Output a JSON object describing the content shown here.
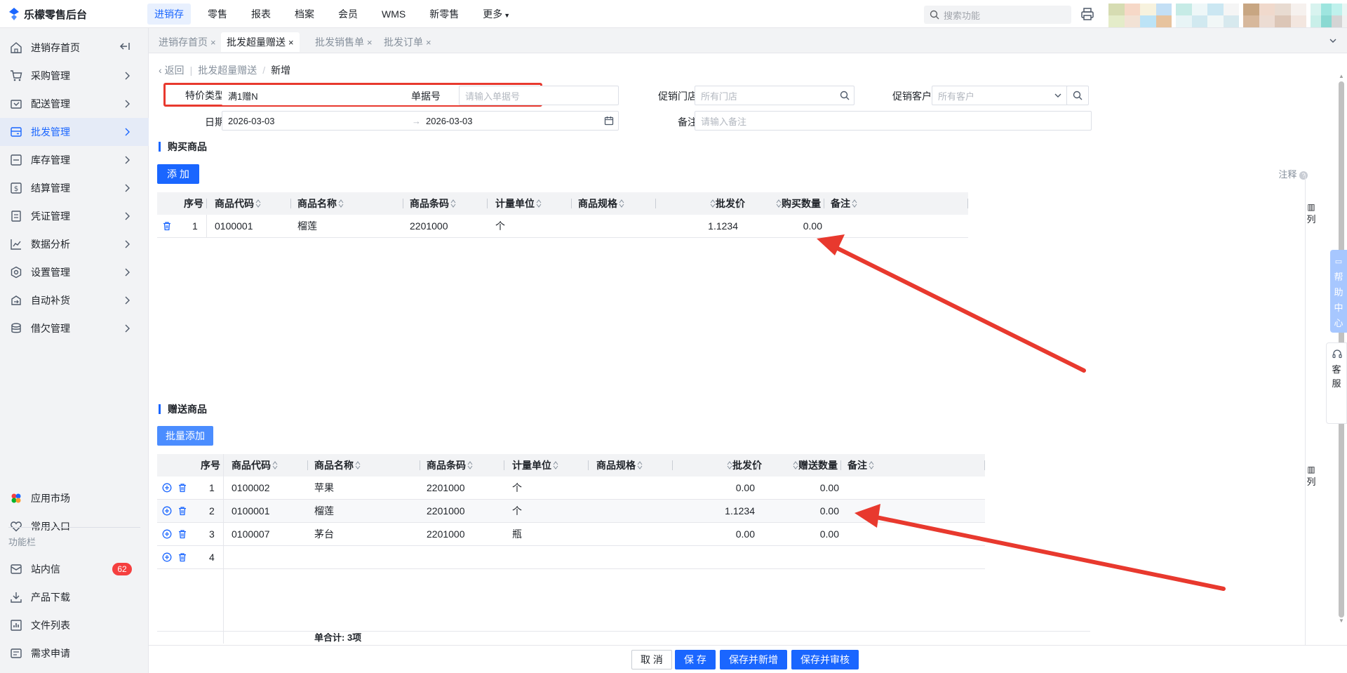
{
  "app": {
    "title": "乐檬零售后台"
  },
  "topnav": {
    "items": [
      "进销存",
      "零售",
      "报表",
      "档案",
      "会员",
      "WMS",
      "新零售",
      "更多"
    ]
  },
  "search": {
    "placeholder": "搜索功能"
  },
  "sidebar": {
    "items": [
      "进销存首页",
      "采购管理",
      "配送管理",
      "批发管理",
      "库存管理",
      "结算管理",
      "凭证管理",
      "数据分析",
      "设置管理",
      "自动补货",
      "借欠管理"
    ],
    "bottom": [
      "应用市场",
      "常用入口"
    ],
    "section_label": "功能栏",
    "tools": [
      "站内信",
      "产品下载",
      "文件列表",
      "需求申请"
    ],
    "message_count": "62"
  },
  "tabs": [
    "进销存首页",
    "批发超量赠送",
    "批发销售单",
    "批发订单"
  ],
  "breadcrumb": {
    "back": "返回",
    "parent": "批发超量赠送",
    "current": "新增"
  },
  "form": {
    "special_type_label": "特价类型",
    "special_type_value": "满1赠N",
    "doc_no_label": "单据号",
    "doc_no_placeholder": "请输入单据号",
    "store_label": "促销门店",
    "store_placeholder": "所有门店",
    "customer_label": "促销客户",
    "customer_placeholder": "所有客户",
    "date_label": "日期",
    "date_start": "2026-03-03",
    "date_end": "2026-03-03",
    "date_sep": "→",
    "remark_label": "备注",
    "remark_placeholder": "请输入备注"
  },
  "purchase": {
    "title": "购买商品",
    "add_label": "添 加",
    "note_label": "注释",
    "col_toggle": "列",
    "columns": [
      "序号",
      "商品代码",
      "商品名称",
      "商品条码",
      "计量单位",
      "商品规格",
      "批发价",
      "购买数量",
      "备注"
    ],
    "rows": [
      {
        "no": "1",
        "code": "0100001",
        "name": "榴莲",
        "barcode": "2201000",
        "unit": "个",
        "spec": "",
        "price": "1.1234",
        "qty": "0.00",
        "remark": ""
      }
    ]
  },
  "gift": {
    "title": "赠送商品",
    "batch_add_label": "批量添加",
    "col_toggle": "列",
    "columns": [
      "序号",
      "商品代码",
      "商品名称",
      "商品条码",
      "计量单位",
      "商品规格",
      "批发价",
      "赠送数量",
      "备注"
    ],
    "rows": [
      {
        "no": "1",
        "code": "0100002",
        "name": "苹果",
        "barcode": "2201000",
        "unit": "个",
        "spec": "",
        "price": "0.00",
        "qty": "0.00",
        "remark": ""
      },
      {
        "no": "2",
        "code": "0100001",
        "name": "榴莲",
        "barcode": "2201000",
        "unit": "个",
        "spec": "",
        "price": "1.1234",
        "qty": "0.00",
        "remark": ""
      },
      {
        "no": "3",
        "code": "0100007",
        "name": "茅台",
        "barcode": "2201000",
        "unit": "瓶",
        "spec": "",
        "price": "0.00",
        "qty": "0.00",
        "remark": ""
      },
      {
        "no": "4",
        "code": "",
        "name": "",
        "barcode": "",
        "unit": "",
        "spec": "",
        "price": "",
        "qty": "",
        "remark": ""
      }
    ],
    "summary": "单合计: 3项"
  },
  "side_tabs": {
    "help": [
      "帮",
      "助",
      "中",
      "心"
    ],
    "service": [
      "客",
      "服"
    ]
  },
  "footer": {
    "cancel": "取 消",
    "save": "保 存",
    "save_new": "保存并新增",
    "save_audit": "保存并审核"
  },
  "colors": {
    "primary": "#1a66ff",
    "annotation": "#e8392e",
    "badge": "#f53f3f"
  }
}
